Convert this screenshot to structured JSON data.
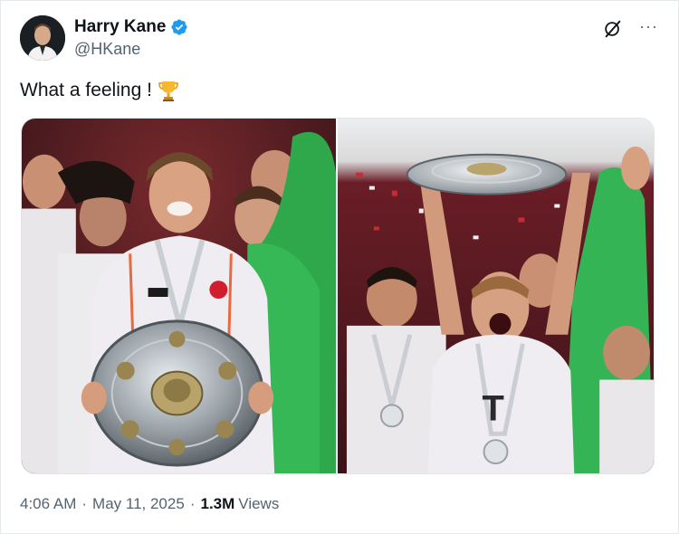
{
  "author": {
    "display_name": "Harry Kane",
    "handle": "@HKane",
    "verified_icon": "verified-badge-icon",
    "verified_color": "#1d9bf0"
  },
  "header_actions": {
    "grok_icon": "grok-icon",
    "more_icon": "more-dots-icon",
    "more_label": "···"
  },
  "tweet": {
    "text": "What a feeling !",
    "emoji": "trophy-emoji"
  },
  "media": {
    "photos": [
      {
        "name": "photo-player-holding-shield"
      },
      {
        "name": "photo-player-lifting-shield"
      }
    ]
  },
  "meta": {
    "time": "4:06 AM",
    "separator": "·",
    "date": "May 11, 2025",
    "views_count": "1.3M",
    "views_label": "Views"
  },
  "colors": {
    "text_primary": "#0f1419",
    "text_secondary": "#536471",
    "accent": "#1d9bf0"
  }
}
